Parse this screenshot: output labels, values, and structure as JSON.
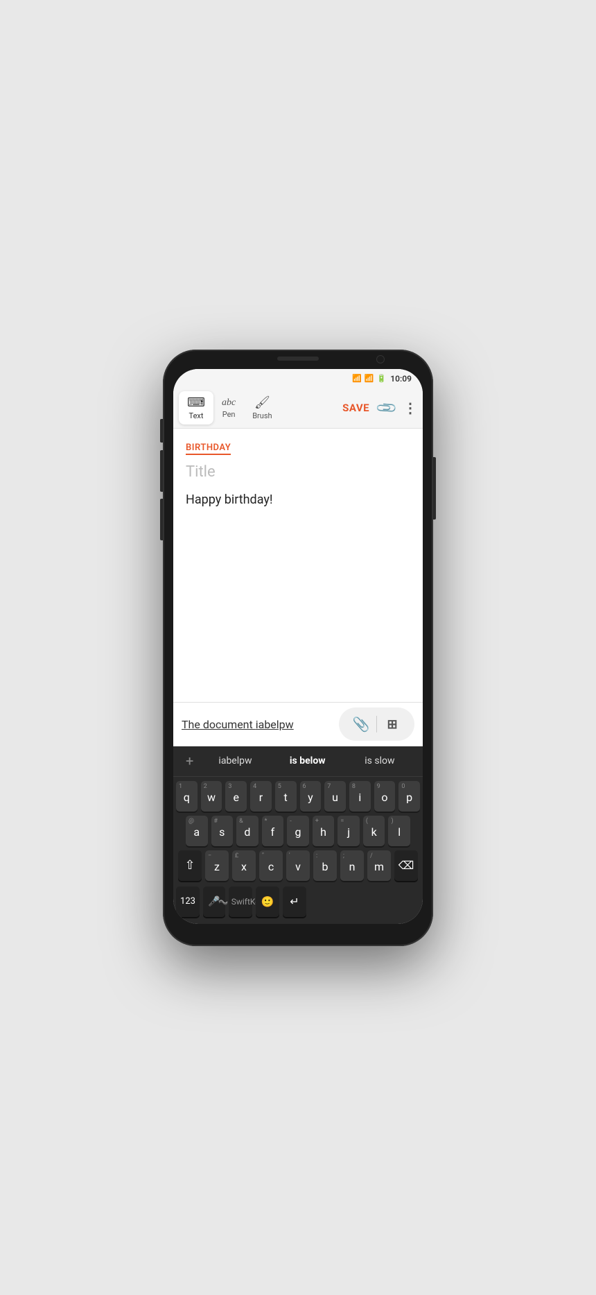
{
  "status_bar": {
    "time": "10:09"
  },
  "toolbar": {
    "tools": [
      {
        "id": "text",
        "label": "Text",
        "icon": "⌨",
        "active": true
      },
      {
        "id": "pen",
        "label": "Pen",
        "icon": "abc",
        "active": false
      },
      {
        "id": "brush",
        "label": "Brush",
        "icon": "🖌",
        "active": false
      }
    ],
    "save_label": "SAVE",
    "attach_icon": "📎",
    "more_icon": "⋮"
  },
  "note": {
    "category": "BIRTHDAY",
    "title_placeholder": "Title",
    "body": "Happy birthday!"
  },
  "input_bar": {
    "text_before": "The document ",
    "text_underlined": "iabelpw",
    "attach_icon": "📎",
    "add_icon": "+"
  },
  "keyboard": {
    "predictions": [
      {
        "text": "+",
        "bold": false
      },
      {
        "text": "iabelpw",
        "bold": false
      },
      {
        "text": "is below",
        "bold": true
      },
      {
        "text": "is slow",
        "bold": false
      }
    ],
    "rows": [
      [
        {
          "num": "1",
          "char": "q"
        },
        {
          "num": "2",
          "char": "w"
        },
        {
          "num": "3",
          "char": "e"
        },
        {
          "num": "4",
          "char": "r"
        },
        {
          "num": "5",
          "char": "t"
        },
        {
          "num": "6",
          "char": "y"
        },
        {
          "num": "7",
          "char": "u"
        },
        {
          "num": "8",
          "char": "i"
        },
        {
          "num": "9",
          "char": "o"
        },
        {
          "num": "0",
          "char": "p"
        }
      ],
      [
        {
          "num": "@",
          "char": "a"
        },
        {
          "num": "#",
          "char": "s"
        },
        {
          "num": "&",
          "char": "d"
        },
        {
          "num": "*",
          "char": "f"
        },
        {
          "num": "-",
          "char": "g"
        },
        {
          "num": "+",
          "char": "h"
        },
        {
          "num": "=",
          "char": "j"
        },
        {
          "num": "(",
          "char": "k"
        },
        {
          "num": ")",
          "char": "l"
        }
      ],
      [
        {
          "num": "−",
          "char": "z"
        },
        {
          "num": "£",
          "char": "x"
        },
        {
          "num": "\"",
          "char": "c"
        },
        {
          "num": "'",
          "char": "v"
        },
        {
          "num": ":",
          "char": "b"
        },
        {
          "num": ";",
          "char": "n"
        },
        {
          "num": "/",
          "char": "m"
        }
      ]
    ],
    "shift_label": "⇧",
    "backspace_label": "⌫",
    "num_label": "123",
    "mic_label": "🎤",
    "comma_label": ",",
    "period_label": ".",
    "emoji_label": "🙂",
    "enter_label": "↵",
    "swiftkey_label": "SwiftKey"
  }
}
